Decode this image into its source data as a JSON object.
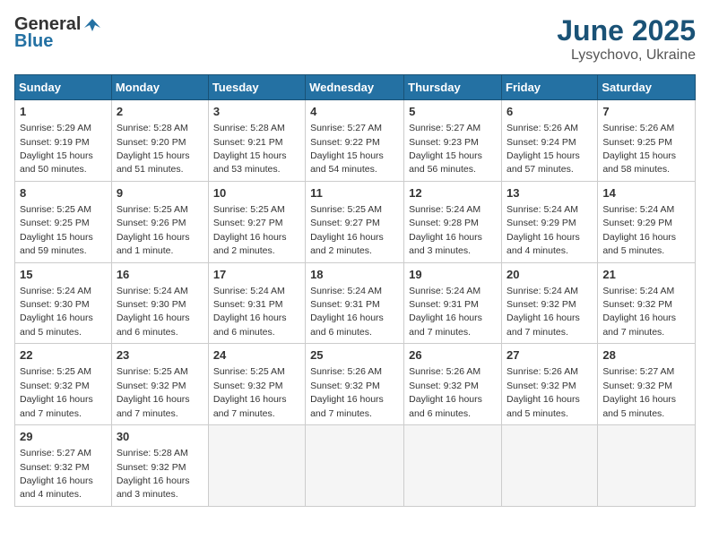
{
  "logo": {
    "general": "General",
    "blue": "Blue"
  },
  "title": "June 2025",
  "subtitle": "Lysychovo, Ukraine",
  "weekdays": [
    "Sunday",
    "Monday",
    "Tuesday",
    "Wednesday",
    "Thursday",
    "Friday",
    "Saturday"
  ],
  "weeks": [
    [
      {
        "day": "1",
        "sunrise": "5:29 AM",
        "sunset": "9:19 PM",
        "daylight": "15 hours and 50 minutes."
      },
      {
        "day": "2",
        "sunrise": "5:28 AM",
        "sunset": "9:20 PM",
        "daylight": "15 hours and 51 minutes."
      },
      {
        "day": "3",
        "sunrise": "5:28 AM",
        "sunset": "9:21 PM",
        "daylight": "15 hours and 53 minutes."
      },
      {
        "day": "4",
        "sunrise": "5:27 AM",
        "sunset": "9:22 PM",
        "daylight": "15 hours and 54 minutes."
      },
      {
        "day": "5",
        "sunrise": "5:27 AM",
        "sunset": "9:23 PM",
        "daylight": "15 hours and 56 minutes."
      },
      {
        "day": "6",
        "sunrise": "5:26 AM",
        "sunset": "9:24 PM",
        "daylight": "15 hours and 57 minutes."
      },
      {
        "day": "7",
        "sunrise": "5:26 AM",
        "sunset": "9:25 PM",
        "daylight": "15 hours and 58 minutes."
      }
    ],
    [
      {
        "day": "8",
        "sunrise": "5:25 AM",
        "sunset": "9:25 PM",
        "daylight": "15 hours and 59 minutes."
      },
      {
        "day": "9",
        "sunrise": "5:25 AM",
        "sunset": "9:26 PM",
        "daylight": "16 hours and 1 minute."
      },
      {
        "day": "10",
        "sunrise": "5:25 AM",
        "sunset": "9:27 PM",
        "daylight": "16 hours and 2 minutes."
      },
      {
        "day": "11",
        "sunrise": "5:25 AM",
        "sunset": "9:27 PM",
        "daylight": "16 hours and 2 minutes."
      },
      {
        "day": "12",
        "sunrise": "5:24 AM",
        "sunset": "9:28 PM",
        "daylight": "16 hours and 3 minutes."
      },
      {
        "day": "13",
        "sunrise": "5:24 AM",
        "sunset": "9:29 PM",
        "daylight": "16 hours and 4 minutes."
      },
      {
        "day": "14",
        "sunrise": "5:24 AM",
        "sunset": "9:29 PM",
        "daylight": "16 hours and 5 minutes."
      }
    ],
    [
      {
        "day": "15",
        "sunrise": "5:24 AM",
        "sunset": "9:30 PM",
        "daylight": "16 hours and 5 minutes."
      },
      {
        "day": "16",
        "sunrise": "5:24 AM",
        "sunset": "9:30 PM",
        "daylight": "16 hours and 6 minutes."
      },
      {
        "day": "17",
        "sunrise": "5:24 AM",
        "sunset": "9:31 PM",
        "daylight": "16 hours and 6 minutes."
      },
      {
        "day": "18",
        "sunrise": "5:24 AM",
        "sunset": "9:31 PM",
        "daylight": "16 hours and 6 minutes."
      },
      {
        "day": "19",
        "sunrise": "5:24 AM",
        "sunset": "9:31 PM",
        "daylight": "16 hours and 7 minutes."
      },
      {
        "day": "20",
        "sunrise": "5:24 AM",
        "sunset": "9:32 PM",
        "daylight": "16 hours and 7 minutes."
      },
      {
        "day": "21",
        "sunrise": "5:24 AM",
        "sunset": "9:32 PM",
        "daylight": "16 hours and 7 minutes."
      }
    ],
    [
      {
        "day": "22",
        "sunrise": "5:25 AM",
        "sunset": "9:32 PM",
        "daylight": "16 hours and 7 minutes."
      },
      {
        "day": "23",
        "sunrise": "5:25 AM",
        "sunset": "9:32 PM",
        "daylight": "16 hours and 7 minutes."
      },
      {
        "day": "24",
        "sunrise": "5:25 AM",
        "sunset": "9:32 PM",
        "daylight": "16 hours and 7 minutes."
      },
      {
        "day": "25",
        "sunrise": "5:26 AM",
        "sunset": "9:32 PM",
        "daylight": "16 hours and 7 minutes."
      },
      {
        "day": "26",
        "sunrise": "5:26 AM",
        "sunset": "9:32 PM",
        "daylight": "16 hours and 6 minutes."
      },
      {
        "day": "27",
        "sunrise": "5:26 AM",
        "sunset": "9:32 PM",
        "daylight": "16 hours and 5 minutes."
      },
      {
        "day": "28",
        "sunrise": "5:27 AM",
        "sunset": "9:32 PM",
        "daylight": "16 hours and 5 minutes."
      }
    ],
    [
      {
        "day": "29",
        "sunrise": "5:27 AM",
        "sunset": "9:32 PM",
        "daylight": "16 hours and 4 minutes."
      },
      {
        "day": "30",
        "sunrise": "5:28 AM",
        "sunset": "9:32 PM",
        "daylight": "16 hours and 3 minutes."
      },
      null,
      null,
      null,
      null,
      null
    ]
  ]
}
